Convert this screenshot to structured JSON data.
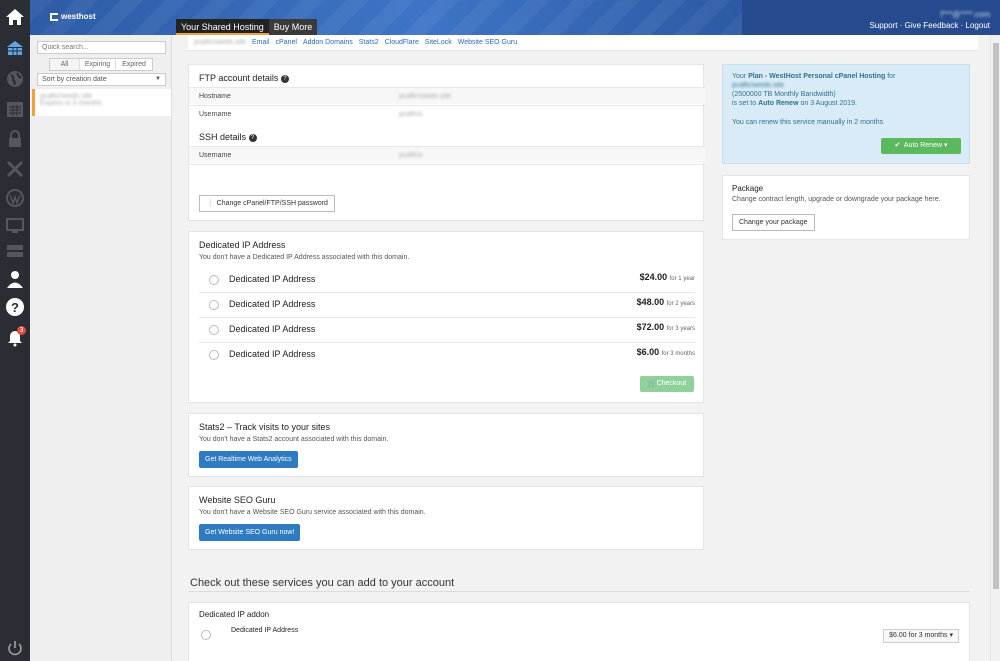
{
  "header": {
    "brand": "westhost",
    "tabs": [
      "Your Shared Hosting",
      "Buy More"
    ],
    "user_email": "f***@****.com",
    "support": "Support",
    "feedback": "Give Feedback",
    "logout": "Logout"
  },
  "rail": {
    "icons": [
      "home-icon",
      "hosting-icon",
      "globe-icon",
      "calendar-icon",
      "lock-icon",
      "tools-icon",
      "wordpress-icon",
      "monitor-icon",
      "server-icon",
      "user-icon",
      "help-icon",
      "bell-icon",
      "power-icon"
    ],
    "notification_count": "3"
  },
  "sidebar": {
    "search_placeholder": "Quick search...",
    "filters": [
      "All",
      "Expiring",
      "Expired"
    ],
    "sort": "Sort by creation date",
    "site_name": "pcaffc/seeds.site",
    "site_sub": "Expires in 3 months"
  },
  "breadcrumbs": {
    "domain": "pcaffc/seeds.site",
    "links": [
      "Email",
      "cPanel",
      "Addon Domains",
      "Stats2",
      "CloudFlare",
      "SiteLock",
      "Website SEO Guru"
    ]
  },
  "ftp": {
    "title": "FTP account details",
    "hostname_label": "Hostname",
    "hostname_value": "pcaffc/seeds.site",
    "username_label": "Username",
    "username_value": "pcaffcis",
    "ssh_title": "SSH details",
    "ssh_username_label": "Username",
    "ssh_username_value": "pcaffcis",
    "password_button": "Change cPanel/FTP/SSH password"
  },
  "dedicated_ip": {
    "title": "Dedicated IP Address",
    "note": "You don't have a Dedicated IP Address associated with this domain.",
    "options": [
      {
        "label": "Dedicated IP Address",
        "price": "$24.00",
        "period": "for 1 year"
      },
      {
        "label": "Dedicated IP Address",
        "price": "$48.00",
        "period": "for 2 years"
      },
      {
        "label": "Dedicated IP Address",
        "price": "$72.00",
        "period": "for 3 years"
      },
      {
        "label": "Dedicated IP Address",
        "price": "$6.00",
        "period": "for 3 months"
      }
    ],
    "checkout": "Checkout"
  },
  "stats2": {
    "title": "Stats2 – Track visits to your sites",
    "note": "You don't have a Stats2 account associated with this domain.",
    "button": "Get Realtime Web Analytics"
  },
  "seo": {
    "title": "Website SEO Guru",
    "note": "You don't have a Website SEO Guru service associated with this domain.",
    "button": "Get Website SEO Guru now!"
  },
  "plan": {
    "line1_prefix": "Your ",
    "plan_name": "Plan - WestHost Personal cPanel Hosting",
    "line1_suffix": " for",
    "domain": "pcaffc/seeds.site",
    "bandwidth": "(2500000 TB Monthly Bandwidth)",
    "renew_prefix": "is set to ",
    "renew_state": "Auto Renew",
    "renew_date": " on 3 August 2019.",
    "manual_note": "You can renew this service manually in 2 months",
    "auto_renew_button": "Auto Renew"
  },
  "package": {
    "title": "Package",
    "note": "Change contract length, upgrade or downgrade your package here.",
    "button": "Change your package"
  },
  "addons": {
    "section_title": "Check out these services you can add to your account",
    "addon_title": "Dedicated IP addon",
    "addon_label": "Dedicated IP Address",
    "addon_select": "$6.00 for 3 months"
  }
}
